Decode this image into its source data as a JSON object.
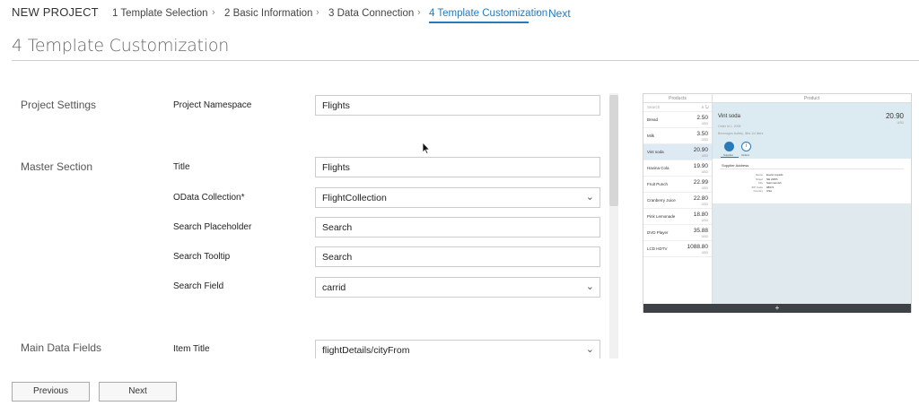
{
  "wizard": {
    "project_title": "NEW PROJECT",
    "steps": [
      {
        "label": "1 Template Selection"
      },
      {
        "label": "2 Basic Information"
      },
      {
        "label": "3 Data Connection"
      },
      {
        "label": "4 Template Customization"
      }
    ],
    "next_label": "Next"
  },
  "page_heading": "4 Template Customization",
  "sections": {
    "project_settings": "Project Settings",
    "master_section": "Master Section",
    "main_data_fields": "Main Data Fields"
  },
  "fields": {
    "project_namespace": {
      "label": "Project Namespace",
      "value": "Flights"
    },
    "title": {
      "label": "Title",
      "value": "Flights"
    },
    "odata_collection": {
      "label": "OData Collection*",
      "value": "FlightCollection"
    },
    "search_placeholder": {
      "label": "Search Placeholder",
      "value": "Search"
    },
    "search_tooltip": {
      "label": "Search Tooltip",
      "value": "Search"
    },
    "search_field": {
      "label": "Search Field",
      "value": "carrid"
    },
    "item_title": {
      "label": "Item Title",
      "value": "flightDetails/cityFrom"
    }
  },
  "preview": {
    "master_header": "Products",
    "detail_header": "Product",
    "search_text": "Search",
    "items": [
      {
        "name": "Bread",
        "price": "2.50",
        "currency": "USD"
      },
      {
        "name": "Milk",
        "price": "3.50",
        "currency": "USD"
      },
      {
        "name": "Vint soda",
        "price": "20.90",
        "currency": "USD",
        "selected": true
      },
      {
        "name": "Havina Cola",
        "price": "19.90",
        "currency": "USD"
      },
      {
        "name": "Fruit Punch",
        "price": "22.99",
        "currency": "USD"
      },
      {
        "name": "Cranberry Juice",
        "price": "22.80",
        "currency": "USD"
      },
      {
        "name": "Pink Lemonade",
        "price": "18.80",
        "currency": "USD"
      },
      {
        "name": "DVD Player",
        "price": "35.88",
        "currency": "USD"
      },
      {
        "name": "LCD HDTV",
        "price": "1088.80",
        "currency": "USD"
      }
    ],
    "object": {
      "title": "Vint soda",
      "price": "20.90",
      "currency": "USD",
      "sub1": "Order Id 1, 2005",
      "sub2": "Beverages bubbly, 3lbs.1/4 liters",
      "tab1_label": "Supplier",
      "tab2_label": "Orders",
      "tab2_icon": "i"
    },
    "supplier": {
      "title": "Supplier Address",
      "rows": [
        {
          "k": "Name",
          "v": "Exotic Liquids"
        },
        {
          "k": "Street",
          "v": "NE 228th"
        },
        {
          "k": "City",
          "v": "Sammamish"
        },
        {
          "k": "ZIP Code",
          "v": "98074"
        },
        {
          "k": "Country",
          "v": "USA"
        }
      ]
    },
    "footer_icon": "+"
  },
  "buttons": {
    "previous": "Previous",
    "next": "Next"
  },
  "colors": {
    "accent": "#2a7ab8",
    "preview_object": "#dcebf1",
    "preview_footer": "#3e4246"
  }
}
